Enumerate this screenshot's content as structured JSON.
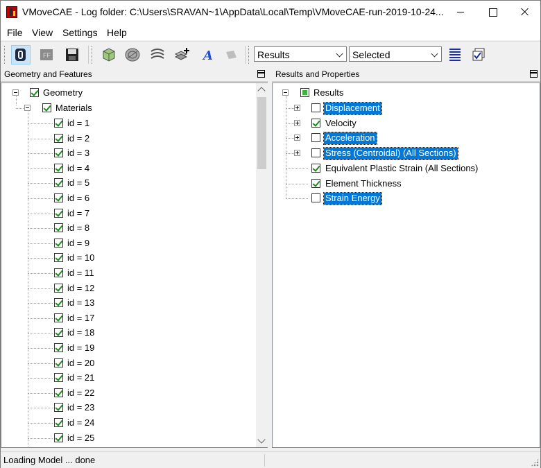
{
  "window": {
    "title": "VMoveCAE - Log folder: C:\\Users\\SRAVAN~1\\AppData\\Local\\Temp\\VMoveCAE-run-2019-10-24..."
  },
  "menu": [
    "File",
    "View",
    "Settings",
    "Help"
  ],
  "toolbar": {
    "icons": [
      "open-icon",
      "ff-icon",
      "save-icon",
      "cube-icon",
      "disc-icon",
      "layers-icon",
      "stack-plus-icon",
      "text-icon",
      "gray-shape-icon",
      "list-lines-icon",
      "checkbox-stack-icon"
    ],
    "results_combo": "Results",
    "selected_combo": "Selected"
  },
  "left_pane": {
    "title": "Geometry and Features",
    "root": {
      "label": "Geometry",
      "checked": true
    },
    "materials": {
      "label": "Materials",
      "checked": true
    },
    "items": [
      "id = 1",
      "id = 2",
      "id = 3",
      "id = 4",
      "id = 5",
      "id = 6",
      "id = 7",
      "id = 8",
      "id = 9",
      "id = 10",
      "id = 11",
      "id = 12",
      "id = 13",
      "id = 17",
      "id = 18",
      "id = 19",
      "id = 20",
      "id = 21",
      "id = 22",
      "id = 23",
      "id = 24",
      "id = 25"
    ]
  },
  "right_pane": {
    "title": "Results and Properties",
    "root": "Results",
    "items": [
      {
        "label": "Displacement",
        "checked": false,
        "expandable": true,
        "selected": true
      },
      {
        "label": "Velocity",
        "checked": true,
        "expandable": true,
        "selected": false
      },
      {
        "label": "Acceleration",
        "checked": false,
        "expandable": true,
        "selected": true
      },
      {
        "label": "Stress (Centroidal) (All Sections)",
        "checked": false,
        "expandable": true,
        "selected": true
      },
      {
        "label": "Equivalent Plastic Strain (All Sections)",
        "checked": true,
        "expandable": false,
        "selected": false
      },
      {
        "label": "Element Thickness",
        "checked": true,
        "expandable": false,
        "selected": false
      },
      {
        "label": "Strain Energy",
        "checked": false,
        "expandable": false,
        "selected": true
      }
    ]
  },
  "status": "Loading Model ... done",
  "colors": {
    "selection": "#0078d7",
    "check": "#1c8a1c",
    "app_icon": "#c00000"
  }
}
